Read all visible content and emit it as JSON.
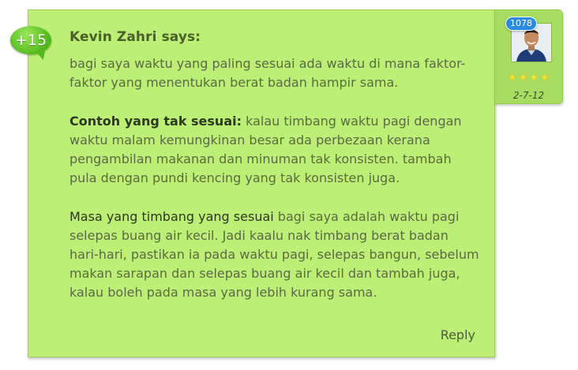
{
  "comment": {
    "author": "Kevin Zahri says:",
    "score": "+15",
    "paragraphs": [
      {
        "lead": "",
        "text": "bagi saya waktu yang paling sesuai ada waktu di mana faktor-faktor yang menentukan berat badan hampir sama."
      },
      {
        "lead": "Contoh yang tak sesuai:",
        "text": " kalau timbang waktu pagi dengan waktu malam kemungkinan besar ada perbezaan kerana pengambilan makanan dan minuman tak konsisten. tambah pula dengan pundi kencing yang tak konsisten juga."
      },
      {
        "lead": "Masa yang timbang yang sesuai",
        "text": " bagi saya adalah waktu pagi selepas buang air kecil. Jadi kaalu nak timbang berat badan hari-hari, pastikan ia pada waktu pagi, selepas bangun, sebelum makan sarapan dan selepas buang air kecil dan tambah juga, kalau boleh pada masa yang lebih kurang sama."
      }
    ],
    "reply_label": "Reply"
  },
  "user": {
    "post_count": "1078",
    "stars": "★★★★",
    "rating": 4,
    "join_date": "2-7-12",
    "avatar": "user-avatar-photo"
  },
  "colors": {
    "card_bg": "#bdee75",
    "panel_bg": "#a9dd62",
    "score_bubble": "#4fb81a",
    "post_count_badge": "#2a8be0",
    "star": "#f6e332"
  }
}
